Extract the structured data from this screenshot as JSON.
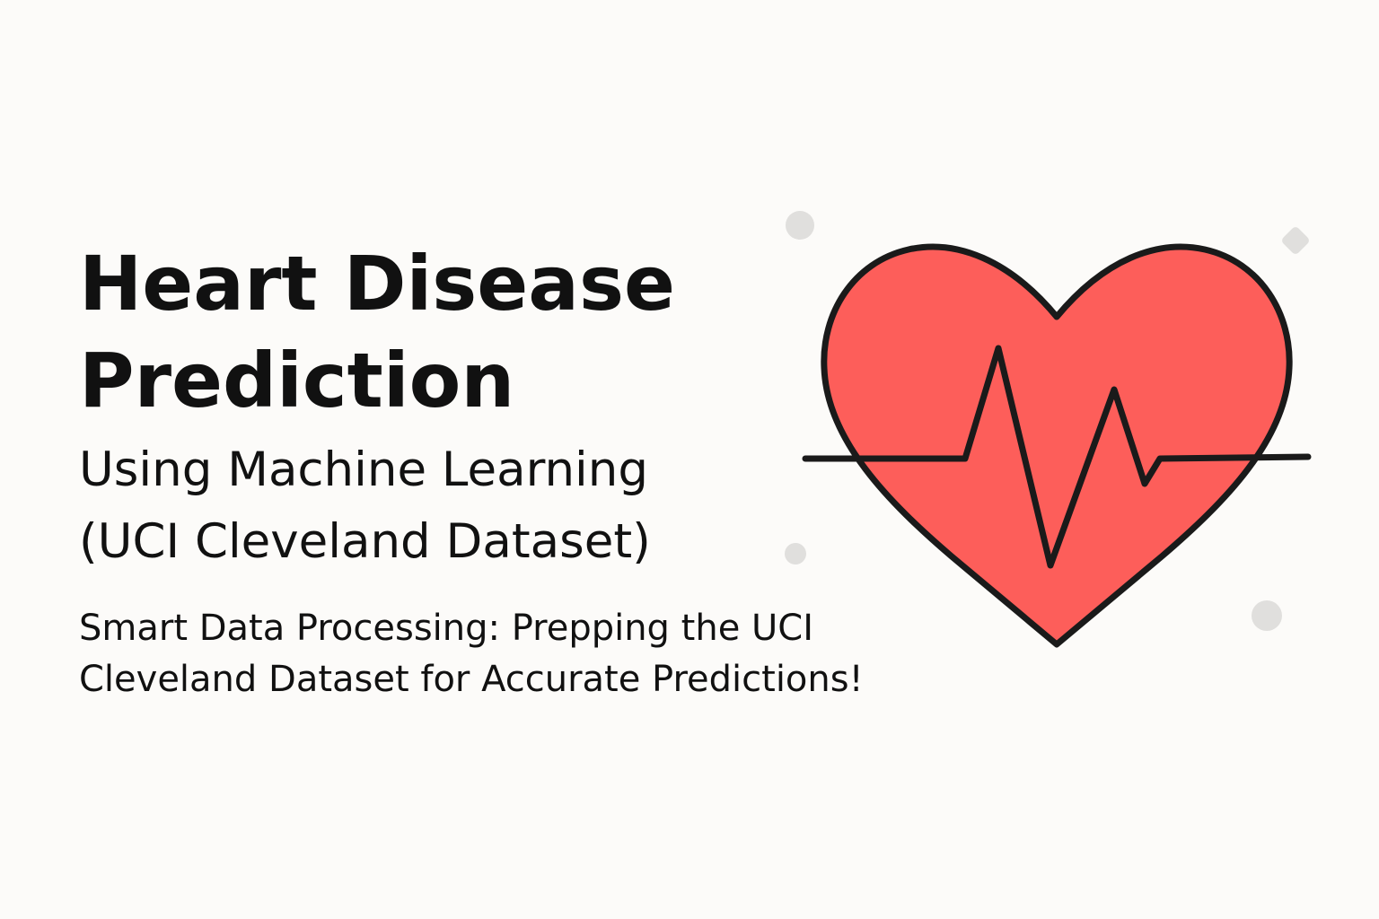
{
  "title": {
    "line1": "Heart Disease",
    "line2": "Prediction"
  },
  "subtitle": {
    "line1": "Using Machine Learning",
    "line2": "(UCI Cleveland Dataset)"
  },
  "tagline": {
    "line1": "Smart Data Processing: Prepping the UCI",
    "line2": "Cleveland Dataset for Accurate Predictions!"
  },
  "icons": {
    "main": "heart-with-heartbeat-icon",
    "decorations": [
      "decor-dot-icon",
      "decor-diamond-icon"
    ]
  },
  "colors": {
    "background": "#fcfbf9",
    "text": "#111111",
    "heart_fill": "#fd5e5a",
    "outline": "#1a1a1a",
    "decoration": "#e0dfdd"
  }
}
